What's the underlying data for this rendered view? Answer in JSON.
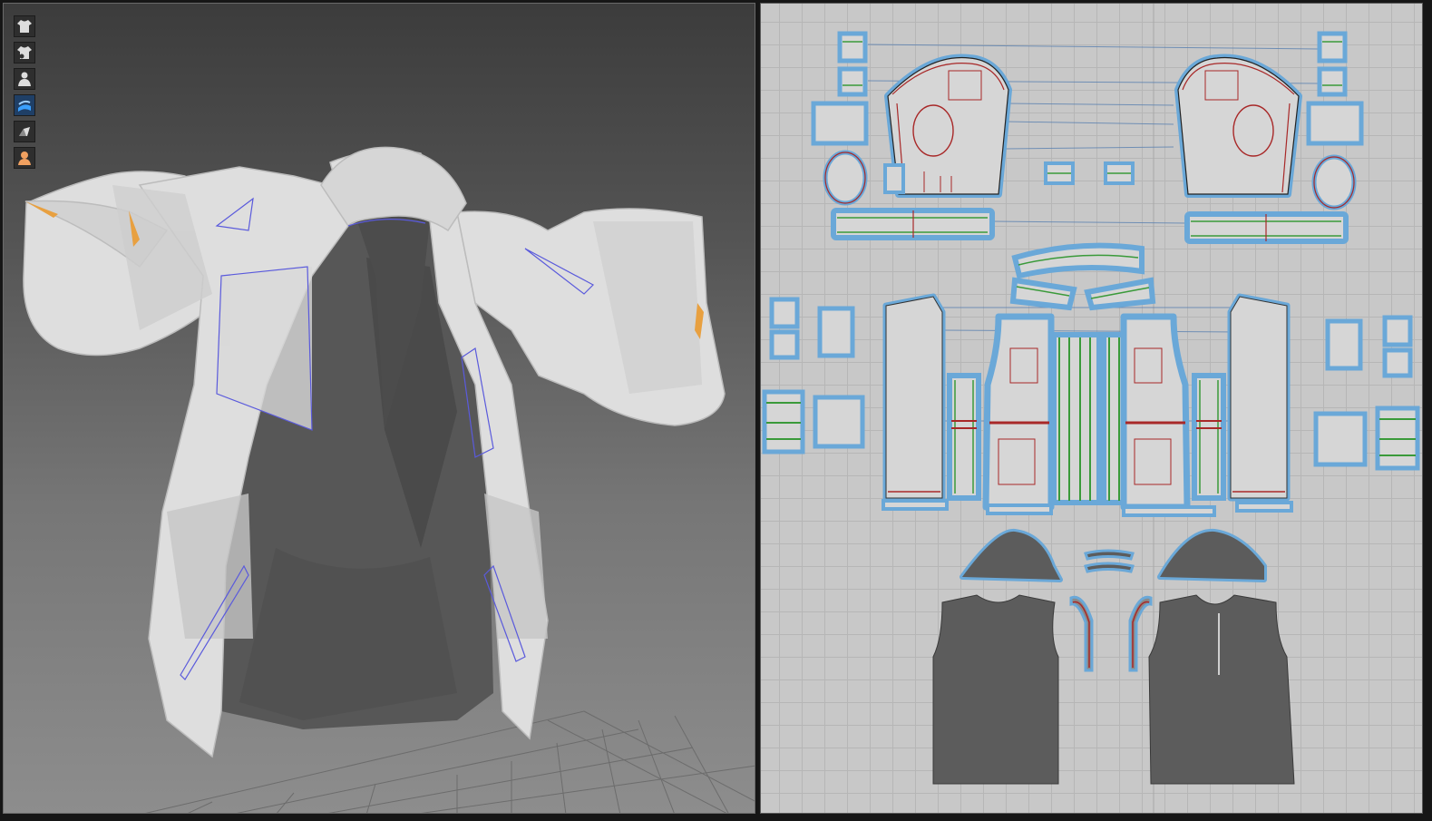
{
  "app": {
    "view_left": "3d-garment-viewport",
    "view_right": "2d-pattern-window"
  },
  "toolbar": {
    "tools": [
      {
        "icon": "garment-shirt-icon",
        "active": false
      },
      {
        "icon": "garment-shirt-visibility-icon",
        "active": false
      },
      {
        "icon": "avatar-icon",
        "active": false
      },
      {
        "icon": "fabric-texture-icon",
        "active": true
      },
      {
        "icon": "pattern-piece-icon",
        "active": false
      },
      {
        "icon": "avatar-skin-icon",
        "active": false
      }
    ]
  },
  "colors": {
    "viewport_top": "#3c3c3c",
    "viewport_bottom": "#8d8d8d",
    "garment_fill": "#e2e2e2",
    "shirt_fill": "#5a5a5a",
    "seam_blue": "#5a5adc",
    "highlight_orange": "#e8a040",
    "pattern_bg": "#c8c8c8",
    "pattern_piece_fill": "#d4d4d4",
    "pattern_outline_blue": "#6aa8d8",
    "seam_red": "#a82828",
    "seam_green": "#3a9a3a",
    "inner_piece_fill": "#5c5c5c"
  }
}
